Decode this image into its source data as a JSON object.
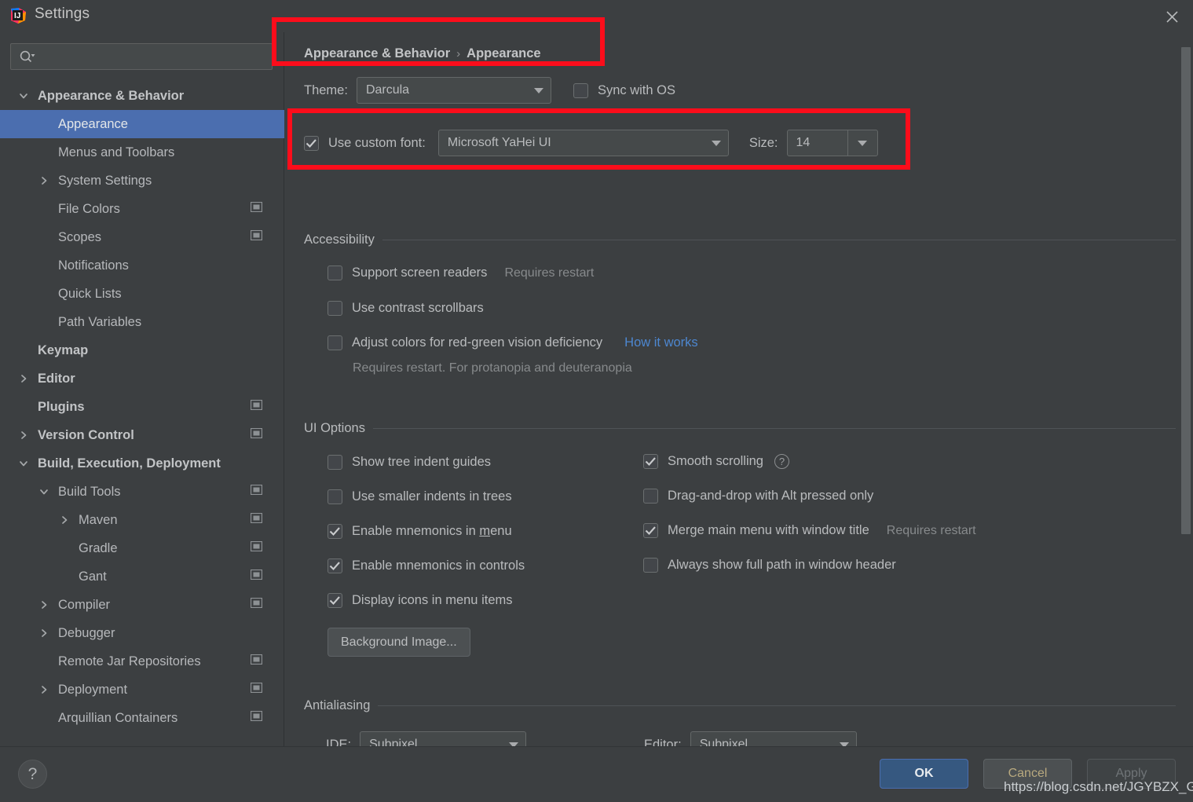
{
  "window": {
    "title": "Settings",
    "logo_icon": "intellij-idea-logo",
    "close_icon": "close-icon"
  },
  "search": {
    "placeholder": "",
    "value": "",
    "icon": "search-icon"
  },
  "sidebar": {
    "items": [
      {
        "label": "Appearance & Behavior",
        "indent": 0,
        "arrow": "chevron-down",
        "bold": true,
        "selected": false,
        "module_icon": false
      },
      {
        "label": "Appearance",
        "indent": 1,
        "arrow": "none",
        "bold": false,
        "selected": true,
        "module_icon": false
      },
      {
        "label": "Menus and Toolbars",
        "indent": 1,
        "arrow": "none",
        "bold": false,
        "selected": false,
        "module_icon": false
      },
      {
        "label": "System Settings",
        "indent": 1,
        "arrow": "chevron-right",
        "bold": false,
        "selected": false,
        "module_icon": false
      },
      {
        "label": "File Colors",
        "indent": 1,
        "arrow": "none",
        "bold": false,
        "selected": false,
        "module_icon": true
      },
      {
        "label": "Scopes",
        "indent": 1,
        "arrow": "none",
        "bold": false,
        "selected": false,
        "module_icon": true
      },
      {
        "label": "Notifications",
        "indent": 1,
        "arrow": "none",
        "bold": false,
        "selected": false,
        "module_icon": false
      },
      {
        "label": "Quick Lists",
        "indent": 1,
        "arrow": "none",
        "bold": false,
        "selected": false,
        "module_icon": false
      },
      {
        "label": "Path Variables",
        "indent": 1,
        "arrow": "none",
        "bold": false,
        "selected": false,
        "module_icon": false
      },
      {
        "label": "Keymap",
        "indent": 0,
        "arrow": "none",
        "bold": true,
        "selected": false,
        "module_icon": false
      },
      {
        "label": "Editor",
        "indent": 0,
        "arrow": "chevron-right",
        "bold": true,
        "selected": false,
        "module_icon": false
      },
      {
        "label": "Plugins",
        "indent": 0,
        "arrow": "none",
        "bold": true,
        "selected": false,
        "module_icon": true
      },
      {
        "label": "Version Control",
        "indent": 0,
        "arrow": "chevron-right",
        "bold": true,
        "selected": false,
        "module_icon": true
      },
      {
        "label": "Build, Execution, Deployment",
        "indent": 0,
        "arrow": "chevron-down",
        "bold": true,
        "selected": false,
        "module_icon": false
      },
      {
        "label": "Build Tools",
        "indent": 1,
        "arrow": "chevron-down",
        "bold": false,
        "selected": false,
        "module_icon": true
      },
      {
        "label": "Maven",
        "indent": 2,
        "arrow": "chevron-right",
        "bold": false,
        "selected": false,
        "module_icon": true
      },
      {
        "label": "Gradle",
        "indent": 2,
        "arrow": "none",
        "bold": false,
        "selected": false,
        "module_icon": true
      },
      {
        "label": "Gant",
        "indent": 2,
        "arrow": "none",
        "bold": false,
        "selected": false,
        "module_icon": true
      },
      {
        "label": "Compiler",
        "indent": 1,
        "arrow": "chevron-right",
        "bold": false,
        "selected": false,
        "module_icon": true
      },
      {
        "label": "Debugger",
        "indent": 1,
        "arrow": "chevron-right",
        "bold": false,
        "selected": false,
        "module_icon": false
      },
      {
        "label": "Remote Jar Repositories",
        "indent": 1,
        "arrow": "none",
        "bold": false,
        "selected": false,
        "module_icon": true
      },
      {
        "label": "Deployment",
        "indent": 1,
        "arrow": "chevron-right",
        "bold": false,
        "selected": false,
        "module_icon": true
      },
      {
        "label": "Arquillian Containers",
        "indent": 1,
        "arrow": "none",
        "bold": false,
        "selected": false,
        "module_icon": true
      }
    ]
  },
  "content": {
    "breadcrumb": {
      "root": "Appearance & Behavior",
      "separator": "›",
      "current": "Appearance"
    },
    "theme": {
      "label": "Theme:",
      "value": "Darcula",
      "sync_label": "Sync with OS",
      "sync_checked": false
    },
    "font": {
      "use_custom_label": "Use custom font:",
      "use_custom_checked": true,
      "font_value": "Microsoft YaHei UI",
      "size_label": "Size:",
      "size_value": "14"
    },
    "accessibility": {
      "title": "Accessibility",
      "screen_readers": {
        "label": "Support screen readers",
        "checked": false,
        "hint": "Requires restart"
      },
      "contrast_scrollbars": {
        "label": "Use contrast scrollbars",
        "checked": false
      },
      "red_green": {
        "label": "Adjust colors for red-green vision deficiency",
        "checked": false,
        "link": "How it works"
      },
      "red_green_note": "Requires restart. For protanopia and deuteranopia"
    },
    "ui_options": {
      "title": "UI Options",
      "left": [
        {
          "label": "Show tree indent guides",
          "checked": false
        },
        {
          "label": "Use smaller indents in trees",
          "checked": false
        },
        {
          "label": "Enable mnemonics in menu",
          "checked": true,
          "mnemonic": "m"
        },
        {
          "label": "Enable mnemonics in controls",
          "checked": true
        },
        {
          "label": "Display icons in menu items",
          "checked": true
        }
      ],
      "right": [
        {
          "label": "Smooth scrolling",
          "checked": true,
          "help": "?"
        },
        {
          "label": "Drag-and-drop with Alt pressed only",
          "checked": false
        },
        {
          "label": "Merge main menu with window title",
          "checked": true,
          "hint": "Requires restart"
        },
        {
          "label": "Always show full path in window header",
          "checked": false
        }
      ],
      "background_image_button": "Background Image..."
    },
    "antialiasing": {
      "title": "Antialiasing",
      "ide_label": "IDE:",
      "ide_value": "Subpixel",
      "editor_label": "Editor:",
      "editor_value": "Subpixel"
    }
  },
  "footer": {
    "help_icon": "question-mark-icon",
    "ok": "OK",
    "cancel": "Cancel",
    "apply": "Apply",
    "watermark": "https://blog.csdn.net/JGYBZX_G"
  },
  "colors": {
    "background": "#3c3f41",
    "selection": "#4b6eaf",
    "accent_link": "#4d87d0",
    "annotation": "#fc0d1b",
    "ok_button": "#365880"
  }
}
